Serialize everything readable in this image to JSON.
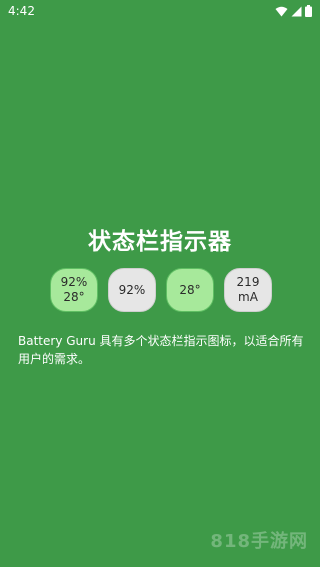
{
  "status_bar": {
    "time": "4:42"
  },
  "main": {
    "title": "状态栏指示器",
    "indicators": [
      {
        "line1": "92%",
        "line2": "28°",
        "style": "green"
      },
      {
        "line1": "92%",
        "line2": "",
        "style": "gray"
      },
      {
        "line1": "28°",
        "line2": "",
        "style": "green"
      },
      {
        "line1": "219",
        "line2": "mA",
        "style": "gray"
      }
    ],
    "description": "Battery Guru 具有多个状态栏指示图标，以适合所有用户的需求。"
  },
  "watermark": "818手游网",
  "colors": {
    "background": "#3e9a48",
    "indicator_green": "#a7e99b",
    "indicator_gray": "#e6e6e6"
  }
}
